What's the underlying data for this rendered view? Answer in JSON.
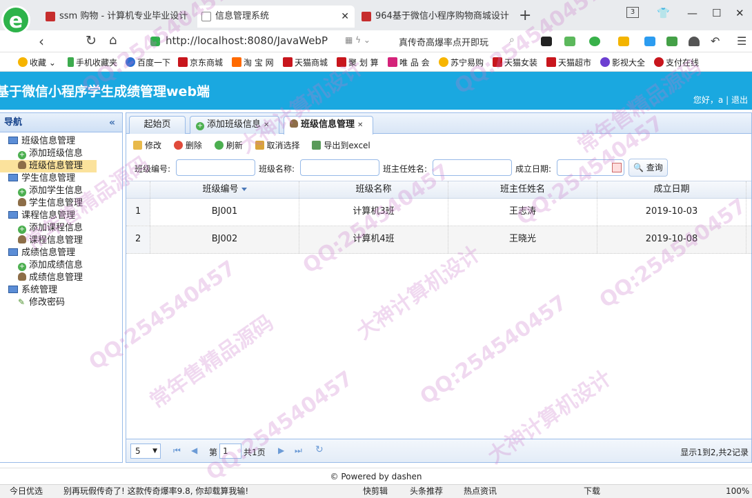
{
  "browser": {
    "tabs": [
      {
        "label": "ssm 购物 - 计算机专业毕业设计",
        "active": false
      },
      {
        "label": "信息管理系统",
        "active": true
      },
      {
        "label": "964基于微信小程序购物商城设计",
        "active": false
      }
    ],
    "tab_count": "3",
    "url": "http://localhost:8080/JavaWebProje",
    "hot_search": "真传奇高爆率点开即玩",
    "bookmarks": [
      "收藏",
      "手机收藏夹",
      "百度一下",
      "京东商城",
      "淘 宝 网",
      "天猫商城",
      "聚 划 算",
      "唯 品 会",
      "苏宁易购",
      "天猫女装",
      "天猫超市",
      "影视大全",
      "支付在线"
    ]
  },
  "header": {
    "title": "基于微信小程序学生成绩管理web端",
    "greeting": "您好，a",
    "separator": "|",
    "logout": "退出"
  },
  "nav": {
    "title": "导航",
    "groups": [
      {
        "label": "班级信息管理",
        "items": [
          {
            "label": "添加班级信息",
            "icon": "add-icon"
          },
          {
            "label": "班级信息管理",
            "icon": "user-icon",
            "selected": true
          }
        ]
      },
      {
        "label": "学生信息管理",
        "items": [
          {
            "label": "添加学生信息",
            "icon": "add-icon"
          },
          {
            "label": "学生信息管理",
            "icon": "user-icon"
          }
        ]
      },
      {
        "label": "课程信息管理",
        "items": [
          {
            "label": "添加课程信息",
            "icon": "add-icon"
          },
          {
            "label": "课程信息管理",
            "icon": "user-icon"
          }
        ]
      },
      {
        "label": "成绩信息管理",
        "items": [
          {
            "label": "添加成绩信息",
            "icon": "add-icon"
          },
          {
            "label": "成绩信息管理",
            "icon": "user-icon"
          }
        ]
      },
      {
        "label": "系统管理",
        "items": [
          {
            "label": "修改密码",
            "icon": "pencil-icon"
          }
        ]
      }
    ]
  },
  "content_tabs": [
    {
      "label": "起始页",
      "closable": false
    },
    {
      "label": "添加班级信息",
      "closable": true
    },
    {
      "label": "班级信息管理",
      "closable": true,
      "active": true
    }
  ],
  "toolbar": {
    "edit": "修改",
    "delete": "删除",
    "refresh": "刷新",
    "deselect": "取消选择",
    "export": "导出到excel"
  },
  "search": {
    "class_no_label": "班级编号:",
    "class_name_label": "班级名称:",
    "teacher_label": "班主任姓名:",
    "date_label": "成立日期:",
    "query": "查询"
  },
  "grid": {
    "columns": [
      "班级编号",
      "班级名称",
      "班主任姓名",
      "成立日期"
    ],
    "rows": [
      {
        "num": "1",
        "class_no": "BJ001",
        "class_name": "计算机3班",
        "teacher": "王志涛",
        "date": "2019-10-03"
      },
      {
        "num": "2",
        "class_no": "BJ002",
        "class_name": "计算机4班",
        "teacher": "王晓光",
        "date": "2019-10-08"
      }
    ]
  },
  "pager": {
    "page_size": "5",
    "page_prefix": "第",
    "page": "1",
    "total_pages": "共1页",
    "summary": "显示1到2,共2记录"
  },
  "footer": "© Powered by dashen",
  "statusbar": {
    "today": "今日优选",
    "news": "别再玩假传奇了! 这款传奇爆率9.8, 你却载算我输!",
    "items": [
      "快剪辑",
      "头条推荐",
      "热点资讯",
      "下载"
    ],
    "zoom": "100%"
  },
  "watermarks": [
    "QQ:254540457",
    "大神计算机设计",
    "常年售精品源码"
  ],
  "colors": {
    "header_bg": "#1aa8e0",
    "panel_border": "#99bbe8",
    "selected_nav": "#fbe29c"
  }
}
